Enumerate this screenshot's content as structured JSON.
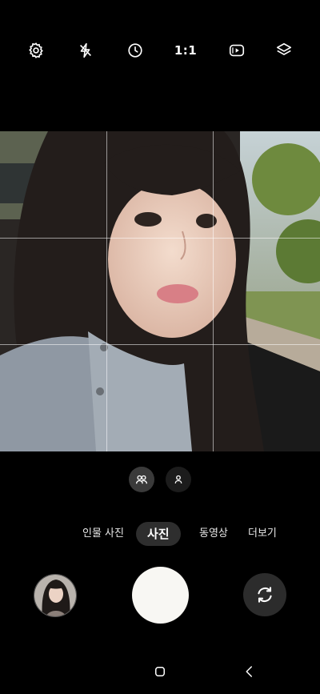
{
  "toolbar": {
    "settings_icon": "gear-icon",
    "flash_icon": "flash-off-icon",
    "timer_icon": "timer-icon",
    "aspect_ratio": "1:1",
    "motion_photo_icon": "motion-photo-icon",
    "filters_icon": "filters-icon"
  },
  "lens": {
    "wide_icon": "group-selfie-icon",
    "normal_icon": "single-person-icon"
  },
  "modes": {
    "portrait": "인물 사진",
    "photo": "사진",
    "video": "동영상",
    "more": "더보기",
    "active": "photo"
  },
  "controls": {
    "gallery_icon": "gallery-thumbnail",
    "shutter_icon": "shutter-button",
    "flip_icon": "switch-camera-icon"
  },
  "nav": {
    "home_icon": "home-icon",
    "back_icon": "back-icon"
  },
  "colors": {
    "background": "#000000",
    "active_mode_bg": "#2e2e2e",
    "shutter": "#f8f7f3",
    "flip_bg": "#2c2c2c"
  }
}
